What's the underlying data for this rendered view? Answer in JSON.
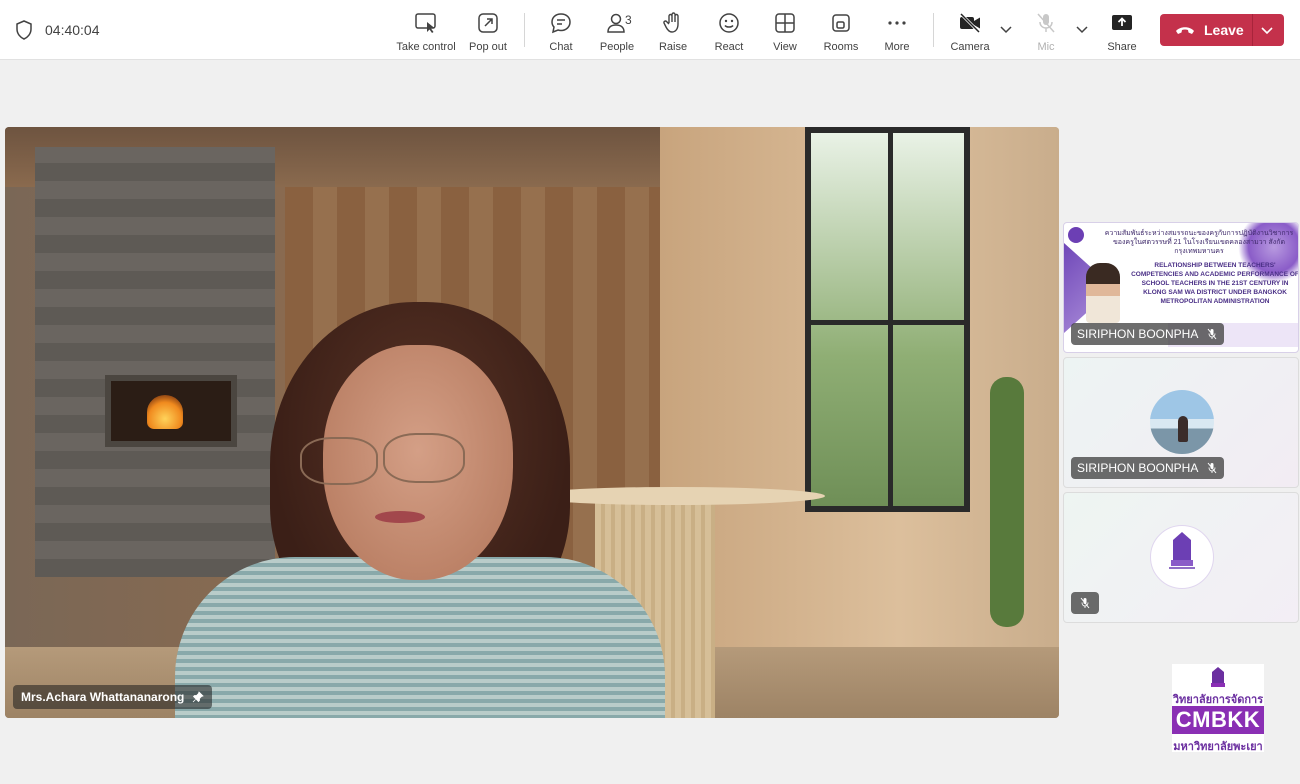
{
  "header": {
    "timer": "04:40:04",
    "buttons": {
      "take_control": "Take control",
      "pop_out": "Pop out",
      "chat": "Chat",
      "people": "People",
      "people_count": "3",
      "raise": "Raise",
      "react": "React",
      "view": "View",
      "rooms": "Rooms",
      "more": "More",
      "camera": "Camera",
      "mic": "Mic",
      "share": "Share",
      "leave": "Leave"
    }
  },
  "main_video": {
    "participant_name": "Mrs.Achara Whattananarong"
  },
  "side_tiles": [
    {
      "participant_name": "SIRIPHON BOONPHA",
      "slide_title_th": "ความสัมพันธ์ระหว่างสมรรถนะของครูกับการปฏิบัติงานวิชาการของครูในศตวรรษที่ 21 ในโรงเรียนเขตคลองสามวา สังกัดกรุงเทพมหานคร",
      "slide_title_en": "RELATIONSHIP BETWEEN TEACHERS' COMPETENCIES AND ACADEMIC PERFORMANCE OF SCHOOL TEACHERS IN THE 21ST CENTURY IN KLONG SAM WA DISTRICT UNDER BANGKOK METROPOLITAN ADMINISTRATION"
    },
    {
      "participant_name": "SIRIPHON BOONPHA"
    },
    {
      "participant_name": ""
    }
  ],
  "logo": {
    "top_text": "วิทยาลัยการจัดการ",
    "main_text": "CMBKK",
    "bottom_text": "มหาวิทยาลัยพะเยา"
  },
  "colors": {
    "leave_red": "#c4314b",
    "brand_purple": "#8a2fb4"
  }
}
